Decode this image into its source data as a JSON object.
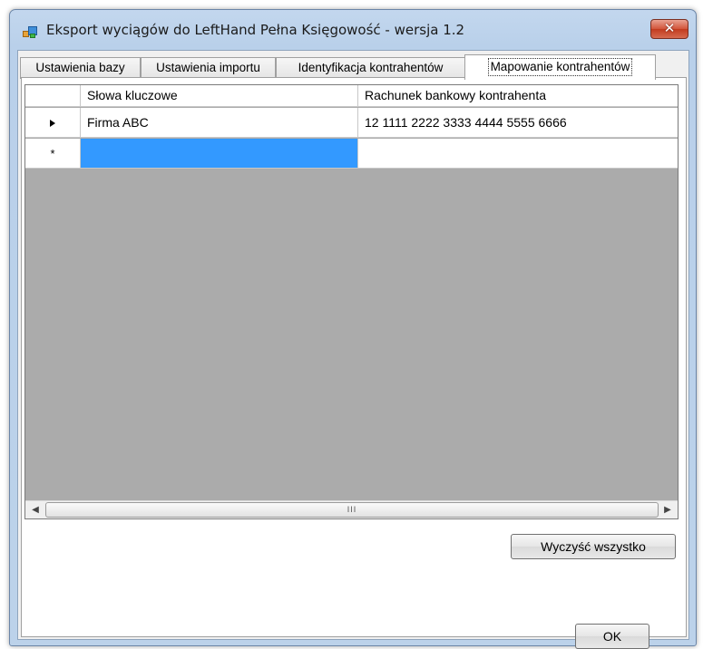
{
  "window": {
    "title": "Eksport wyciągów do LeftHand Pełna Księgowość - wersja 1.2",
    "close_label": "✕"
  },
  "tabs": [
    {
      "label": "Ustawienia bazy",
      "active": false
    },
    {
      "label": "Ustawienia importu",
      "active": false
    },
    {
      "label": "Identyfikacja kontrahentów",
      "active": false
    },
    {
      "label": "Mapowanie kontrahentów",
      "active": true
    }
  ],
  "grid": {
    "columns": [
      "Słowa kluczowe",
      "Rachunek bankowy kontrahenta"
    ],
    "rows": [
      {
        "keywords": "Firma ABC",
        "account": "12 1111 2222 3333 4444 5555 6666"
      }
    ],
    "new_row_marker": "*",
    "scroll_grip": "III"
  },
  "buttons": {
    "clear_all": "Wyczyść wszystko",
    "ok": "OK"
  },
  "colors": {
    "selection": "#3399ff",
    "grid_background": "#ababab",
    "window_frame": "#bcd2ea"
  }
}
